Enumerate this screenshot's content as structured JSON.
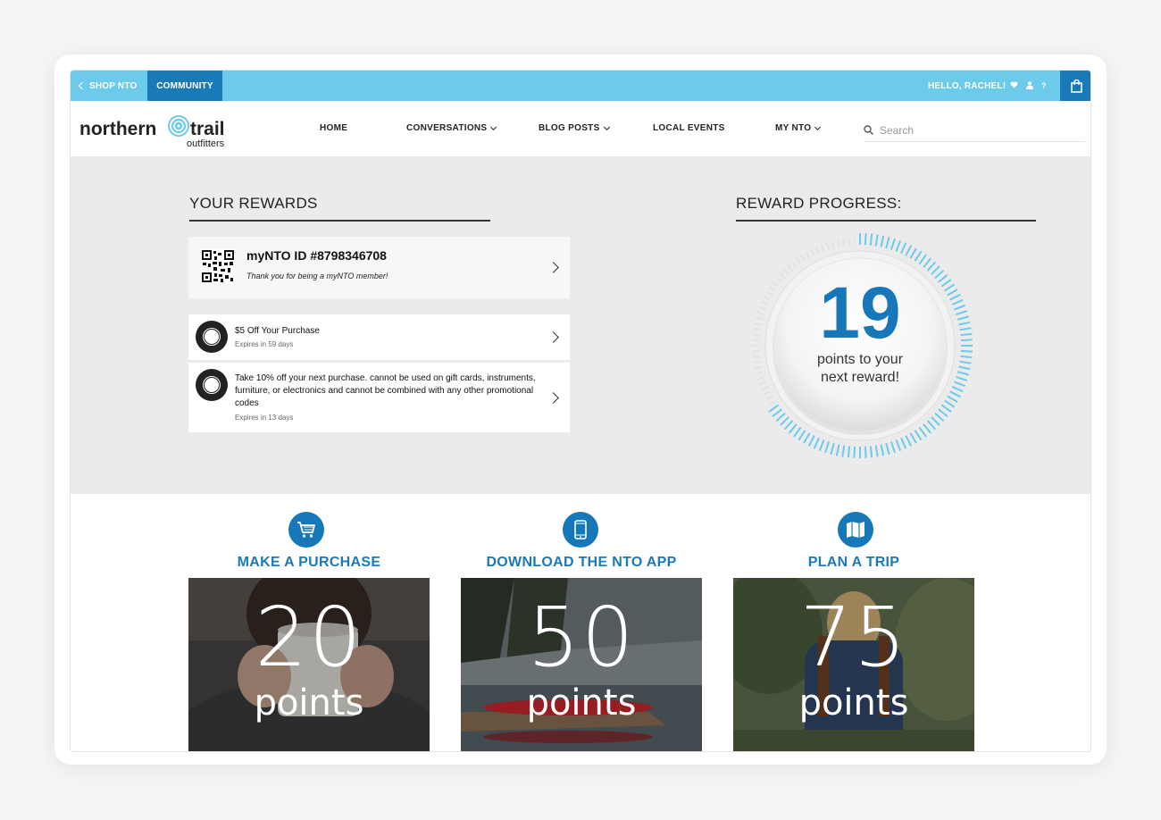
{
  "topbar": {
    "shop_label": "SHOP NTO",
    "community_label": "COMMUNITY",
    "greeting": "HELLO, RACHEL!",
    "help_label": "?"
  },
  "nav": {
    "items": [
      {
        "label": "HOME"
      },
      {
        "label": "CONVERSATIONS"
      },
      {
        "label": "BLOG POSTS"
      },
      {
        "label": "LOCAL EVENTS"
      },
      {
        "label": "MY NTO"
      }
    ],
    "search_placeholder": "Search"
  },
  "logo": {
    "word1": "northern",
    "word2": "trail",
    "tagline": "outfitters"
  },
  "rewards": {
    "title": "YOUR REWARDS",
    "member": {
      "id_label": "myNTO ID #8798346708",
      "note": "Thank you for being a myNTO member!"
    },
    "coupons": [
      {
        "title": "$5 Off Your Purchase",
        "expires": "Expires in 59 days"
      },
      {
        "title": "Take 10% off your next purchase. cannot be used on gift cards, instruments, furniture, or electronics and cannot be combined with any other promotional codes",
        "expires": "Expires in 13 days"
      }
    ]
  },
  "progress": {
    "title": "REWARD PROGRESS:",
    "points": "19",
    "caption_line1": "points to your",
    "caption_line2": "next reward!",
    "fraction_complete": 0.65
  },
  "earn": [
    {
      "label": "MAKE A PURCHASE",
      "points": "20",
      "unit": "points",
      "icon": "cart-icon"
    },
    {
      "label": "DOWNLOAD THE NTO APP",
      "points": "50",
      "unit": "points",
      "icon": "phone-icon"
    },
    {
      "label": "PLAN A TRIP",
      "points": "75",
      "unit": "points",
      "icon": "map-icon"
    }
  ],
  "colors": {
    "accent": "#6ccaeb",
    "brand": "#1a7ab8",
    "number": "#1678b8"
  }
}
